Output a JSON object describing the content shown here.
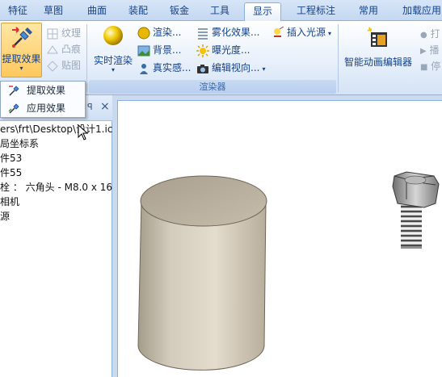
{
  "tabs": [
    "特征",
    "草图",
    "曲面",
    "装配",
    "钣金",
    "工具",
    "显示",
    "工程标注",
    "常用",
    "加载应用"
  ],
  "active_tab": "显示",
  "ribbon": {
    "extract": {
      "label": "提取效果"
    },
    "texture": "纹理",
    "emboss": "凸痕",
    "decal": "贴图",
    "realtime_render": "实时渲染",
    "render": "渲染...",
    "background": "背景...",
    "realism": "真实感...",
    "fog": "雾化效果...",
    "exposure": "曝光度...",
    "edit_view": "编辑视向...",
    "insert_light": "插入光源",
    "renderer_group": "渲染器",
    "animation_editor": "智能动画编辑器",
    "right_col": [
      "打",
      "播",
      "停"
    ]
  },
  "dropdown": {
    "items": [
      "提取效果",
      "应用效果"
    ]
  },
  "tree": {
    "pin_glyph": "ꟼ",
    "close_glyph": "×",
    "items": [
      "ers\\frt\\Desktop\\设计1.ic",
      "局坐标系",
      "件53",
      "件55",
      "栓 ： 六角头 - M8.0 x 16",
      "相机",
      "源"
    ]
  },
  "colors": {
    "ribbon_text": "#15428b",
    "tab_bg": "#c4d8f1",
    "pressed": "#ffc85f",
    "cylinder": "#d4ccbc"
  }
}
